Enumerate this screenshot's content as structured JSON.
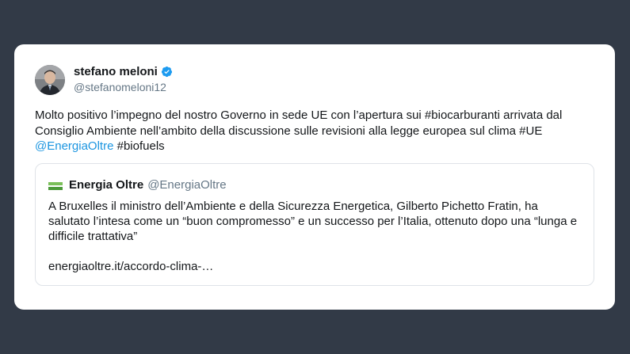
{
  "author": {
    "name": "stefano meloni",
    "handle": "@stefanomeloni12"
  },
  "tweet": {
    "segments": [
      {
        "text": "Molto positivo l’impegno del nostro Governo in sede UE  con l’apertura sui #biocarburanti arrivata dal Consiglio Ambiente nell’ambito della discussione sulle revisioni alla legge europea sul clima #UE ",
        "type": "text"
      },
      {
        "text": "@EnergiaOltre",
        "type": "mention"
      },
      {
        "text": " #biofuels",
        "type": "text"
      }
    ]
  },
  "quote": {
    "name": "Energia Oltre",
    "handle": "@EnergiaOltre",
    "text": "A Bruxelles il ministro dell’Ambiente e della Sicurezza Energetica, Gilberto Pichetto Fratin, ha salutato l’intesa come un “buon compromesso” e un successo per l’Italia, ottenuto dopo una “lunga e difficile trattativa”",
    "link": "energiaoltre.it/accordo-clima-…"
  },
  "colors": {
    "background": "#323a47",
    "card": "#ffffff",
    "link": "#1b95e0",
    "verified": "#1d9bf0",
    "secondary_text": "#657786"
  }
}
